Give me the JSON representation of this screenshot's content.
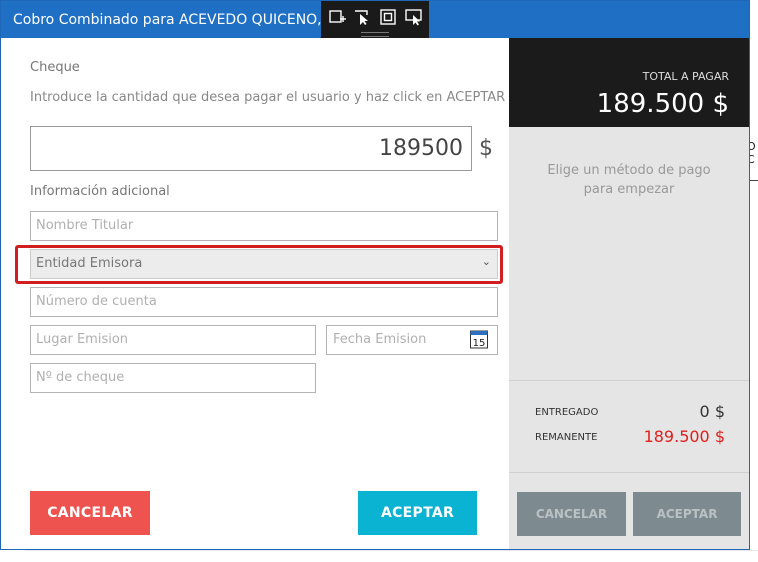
{
  "window": {
    "title": "Cobro Combinado para ACEVEDO QUICENO, VALENTINA"
  },
  "toolbar": {
    "icons": [
      "add-frame-icon",
      "select-cursor-icon",
      "focus-frame-icon",
      "screen-cursor-icon"
    ]
  },
  "form": {
    "section_title": "Cheque",
    "instructions": "Introduce la cantidad que desea pagar el usuario y haz click en ACEPTAR",
    "amount": "189500",
    "currency": "$",
    "additional_title": "Información adicional",
    "holder_placeholder": "Nombre Titular",
    "entity_selected": "Entidad Emisora",
    "account_placeholder": "Número de cuenta",
    "place_placeholder": "Lugar Emision",
    "date_placeholder": "Fecha Emision",
    "calendar_day": "15",
    "check_number_placeholder": "Nº de cheque",
    "cancel_label": "CANCELAR",
    "accept_label": "ACEPTAR"
  },
  "summary": {
    "total_label": "TOTAL A PAGAR",
    "total_value": "189.500 $",
    "method_line1": "Elige un método de pago",
    "method_line2": "para empezar",
    "delivered_label": "ENTREGADO",
    "delivered_value": "0 $",
    "remaining_label": "REMANENTE",
    "remaining_value": "189.500 $",
    "cancel_label": "CANCELAR",
    "accept_label": "ACEPTAR"
  },
  "background": {
    "partial_text_line1": "O",
    "partial_text_line2": "C"
  },
  "colors": {
    "titlebar": "#1f6fc5",
    "cancel": "#ee5350",
    "accept": "#0ab3d1",
    "highlight": "#d11f1f",
    "remaining": "#e0201b",
    "total_bg": "#1b1b1b"
  }
}
